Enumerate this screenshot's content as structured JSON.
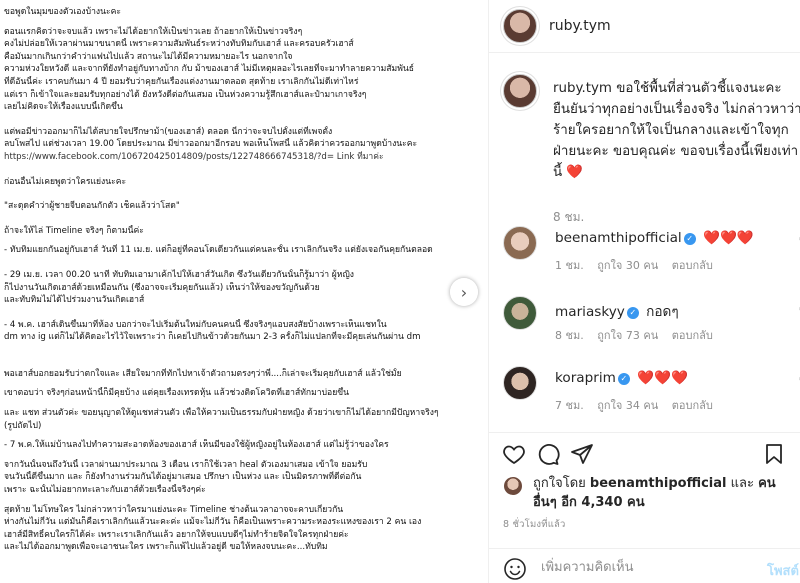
{
  "post": {
    "document_lines": [
      {
        "t": "ขอพูดในมุมของตัวเองบ้างนะคะ",
        "gap": ""
      },
      {
        "t": "",
        "gap": "s"
      },
      {
        "t": "      ตอนแรกคิดว่าจะจบแล้ว เพราะไม่ได้อยากให้เป็นข่าวเลย  ถ้าอยากให้เป็นข่าวจริงๆ",
        "gap": ""
      },
      {
        "t": "คงไม่ปล่อยให้เวลาผ่านมาขนาดนี้  เพราะความสัมพันธ์ระหว่างทับทิมกับเฮาส์  และครอบครัวเฮาส์",
        "gap": ""
      },
      {
        "t": "คือมันมากเกินกว่าคำว่าแฟนไปแล้ว สถานะไม่ได้มีความหมายอะไร นอกจากใจ",
        "gap": ""
      },
      {
        "t": "ความห่วงใยหวังดี และจากที่ยังทำอยู่กับทางบ้าก กับ ม้าของเฮาส์ ไม่มีเหตุผลอะไรเลยที่จะมาทำลายความสัมพันธ์",
        "gap": ""
      },
      {
        "t": "ที่ดีอันนี้ค่ะ เราคบกันมา 4 ปี ยอมรับว่าคุยกันเรื่องแต่งงานมาตลอด  สุดท้าย เราเลิกกันไม่ดีเท่าไหร่",
        "gap": ""
      },
      {
        "t": "แต่เรา  ก็เข้าใจและยอมรับทุกอย่างได้ ยังหวังดีต่อกันเสมอ เป็นห่วงความรู้สึกเฮาส์และป๋ามาเกาจริงๆ",
        "gap": ""
      },
      {
        "t": "เลยไม่คิดจะให้เรื่องแบบนี้เกิดขึ้น",
        "gap": ""
      },
      {
        "t": "",
        "gap": "m"
      },
      {
        "t": "แต่พอมีข่าวออกมาก็ไม่ได้สบายใจปรึกษาม้า(ของเฮาส์) ตลอด  นี่กว่าจะจบไปตั้งแต่ที่เพจตั้ง",
        "gap": ""
      },
      {
        "t": "ลบโพสไป แต่ช่วงเวลา 19.00 โดยประมาณ มีข่าวออกมาอีกรอบ พอเห็นโพสนี้ แล้วคิดว่าควรออกมาพูดบ้างนะคะ",
        "gap": ""
      },
      {
        "t": "https://www.facebook.com/106720425014809/posts/122748666745318/?d=      Link ที่มาค่ะ",
        "gap": "",
        "link": true
      },
      {
        "t": "",
        "gap": "m"
      },
      {
        "t": "ก่อนอื่นไม่เคยพูดว่าใครแย่งนะคะ",
        "gap": ""
      },
      {
        "t": "",
        "gap": "m"
      },
      {
        "t": "\"สะดุดคำว่าผู้ชายจีบตอนกักตัว เช็คแล้วว่าโสด\"",
        "gap": ""
      },
      {
        "t": "",
        "gap": "m"
      },
      {
        "t": "ถ้าจะให้ไล่ Timeline จริงๆ ก็ตามนี้ค่ะ",
        "gap": ""
      },
      {
        "t": "",
        "gap": "s"
      },
      {
        "t": "- ทับทิมแยกกันอยู่กับเฮาส์ วันที่ 11 เม.ย. แต่ก็อยู่ที่คอนโดเดียวกันแต่คนละชั้น เราเลิกกันจริง แต่ยังเจอกันคุยกันตลอด",
        "gap": ""
      },
      {
        "t": "",
        "gap": "m"
      },
      {
        "t": "- 29 เม.ย. เวลา 00.20 นาที ทับทิมเอามาเค้กไปให้เฮาส์วันเกิด ซึ่งวันเดียวกันนั้นก็รู้มาว่า ผู้หญิง",
        "gap": ""
      },
      {
        "t": "ก็ไปงานวันเกิดเฮาส์ด้วยเหมือนกัน (ซึ่งอาจจะเริ่มคุยกันแล้ว) เห็นว่าให้ของขวัญกันด้วย",
        "gap": ""
      },
      {
        "t": "และทับทิมไม่ได้ไปร่วมงานวันเกิดเฮาส์",
        "gap": ""
      },
      {
        "t": "",
        "gap": "m"
      },
      {
        "t": "- 4 พ.ค. เฮาส์เดินขึ้นมาที่ห้อง บอกว่าจะไปเริ่มต้นใหม่กับคนคนนี้ ซึ่งจริงๆแอบสงสัยบ้างเพราะเห็นแชทใน",
        "gap": ""
      },
      {
        "t": "dm ทาง ig แต่ก็ไม่ได้คิดอะไรไว้ใจเพราะว่า ก็เคยไปกินข้าวด้วยกันมา 2-3 ครั้งก็ไม่แปลกที่จะมีคุยเล่นกันผ่าน dm",
        "gap": ""
      },
      {
        "t": "",
        "gap": "l"
      },
      {
        "t": "  พอเฮาส์บอกยอมรับว่าตกใจและ เสียใจมากที่ทักไปหาเจ้าตัวถามตรงๆว่าพี่....ก็เล่าจะเริ่มคุยกับเฮาส์ แล้วใช่มั้ย",
        "gap": ""
      },
      {
        "t": "",
        "gap": "s"
      },
      {
        "t": "  เขาตอบว่า จริงๆก่อนหน้านี้ก็มีคุยบ้าง แต่คุยเรื่องเทรดหุ้น แล้วช่วงติดโควิดที่เฮาส์ทักมาบ่อยขึ้น",
        "gap": ""
      },
      {
        "t": "",
        "gap": "s"
      },
      {
        "t": "  และ แชท ส่วนตัวค่ะ ขอยนุญาตให้ดูแชทส่วนตัว เพื่อให้ความเป็นธรรมกับฝ่ายหญิง ด้วยว่าเขาก็ไม่ได้อยากมีปัญหาจริงๆ",
        "gap": ""
      },
      {
        "t": "  (รูปถัดไป)",
        "gap": ""
      },
      {
        "t": "",
        "gap": "s"
      },
      {
        "t": "- 7 พ.ค.ให้แม่บ้านลงไปทำความสะอาดห้องของเฮาส์ เห็นมีของใช้ผู้หญิงอยู่ในห้องเฮาส์ แต่ไม่รู้ว่าของใคร",
        "gap": ""
      },
      {
        "t": "",
        "gap": "s"
      },
      {
        "t": "  จากวันนั้นจนถึงวันนี้ เวลาผ่านมาประมาณ 3 เดือน เราก็ใช้เวลา heal ตัวเองมาเสมอ เข้าใจ ยอมรับ",
        "gap": ""
      },
      {
        "t": "  จนวันนี้ดีขึ้นมาก และ ก็ยังทำงานร่วมกันได้อยู่มาเสมอ ปรึกษา เป็นห่วง และ เป็นมิตรภาพที่ดีต่อกัน",
        "gap": ""
      },
      {
        "t": "  เพราะ ฉะนั้นไม่อยากทะเลาะกับเฮาส์ด้วยเรื่องนี้จริงๆค่ะ",
        "gap": ""
      },
      {
        "t": "",
        "gap": "s"
      },
      {
        "t": "  สุดท้าย ไม่โทษใคร ไม่กล่าวหาว่าใครมาแย่งนะคะ  Timeline ช่างต้นเวลาอาจจะคาบเกี่ยวกัน",
        "gap": ""
      },
      {
        "t": "  ห่างกันไม่กี่วัน แต่มันก็คือเราเลิกกันแล้วนะคะค่ะ แม้จะไม่กี่วัน ก็คือเป็นเพราะความระหองระแหงของเรา 2 คน เอง",
        "gap": ""
      },
      {
        "t": "  เฮาส์มีสิทธิ์คบใครก็ได้ค่ะ เพราะเราเลิกกันแล้ว  อยากให้จบแบบดีๆไม่ทำร้ายจิตใจใครทุกฝ่ายค่ะ",
        "gap": ""
      },
      {
        "t": "  และไม่ได้ออกมาพูดเพื่อจะเอาชนะใคร เพราะก็แพ้ไปแล้วอยู่ดี ขอให้หลงจบนะคะ...ทับทิม",
        "gap": ""
      }
    ]
  },
  "header": {
    "username": "ruby.tym"
  },
  "caption": {
    "username": "ruby.tym",
    "text": "ขอใช้พื้นที่ส่วนตัวชี้แจงนะคะ ยืนยันว่าทุกอย่างเป็นเรื่องจริง ไม่กล่าวหาว่าร้ายใครอยากให้ใจเป็นกลางและเข้าใจทุกฝ่ายนะคะ ขอบคุณค่ะ ขอจบเรื่องนี้เพียงเท่านี้",
    "emoji": "❤️",
    "time": "8 ชม."
  },
  "comments": [
    {
      "username": "beenamthipofficial",
      "verified": true,
      "text": "❤️❤️❤️",
      "age": "1 ชม.",
      "likes": "ถูกใจ 30 คน",
      "reply": "ตอบกลับ"
    },
    {
      "username": "mariaskyy",
      "verified": true,
      "text": "กอดๆ",
      "age": "8 ชม.",
      "likes": "ถูกใจ 73 คน",
      "reply": "ตอบกลับ"
    },
    {
      "username": "koraprim",
      "verified": true,
      "text": "❤️❤️❤️",
      "age": "7 ชม.",
      "likes": "ถูกใจ 34 คน",
      "reply": "ตอบกลับ"
    }
  ],
  "likes": {
    "prefix": "ถูกใจโดย",
    "user": "beenamthipofficial",
    "connector": "และ",
    "others": "คนอื่นๆ อีก 4,340 คน"
  },
  "timestamp": "8 ชั่วโมงที่แล้ว",
  "comment_box": {
    "placeholder": "เพิ่มความคิดเห็น",
    "post_label": "โพสต์"
  },
  "icons": [
    "heart-icon",
    "comment-icon",
    "share-icon",
    "save-icon",
    "emoji-icon",
    "next-arrow-icon"
  ]
}
